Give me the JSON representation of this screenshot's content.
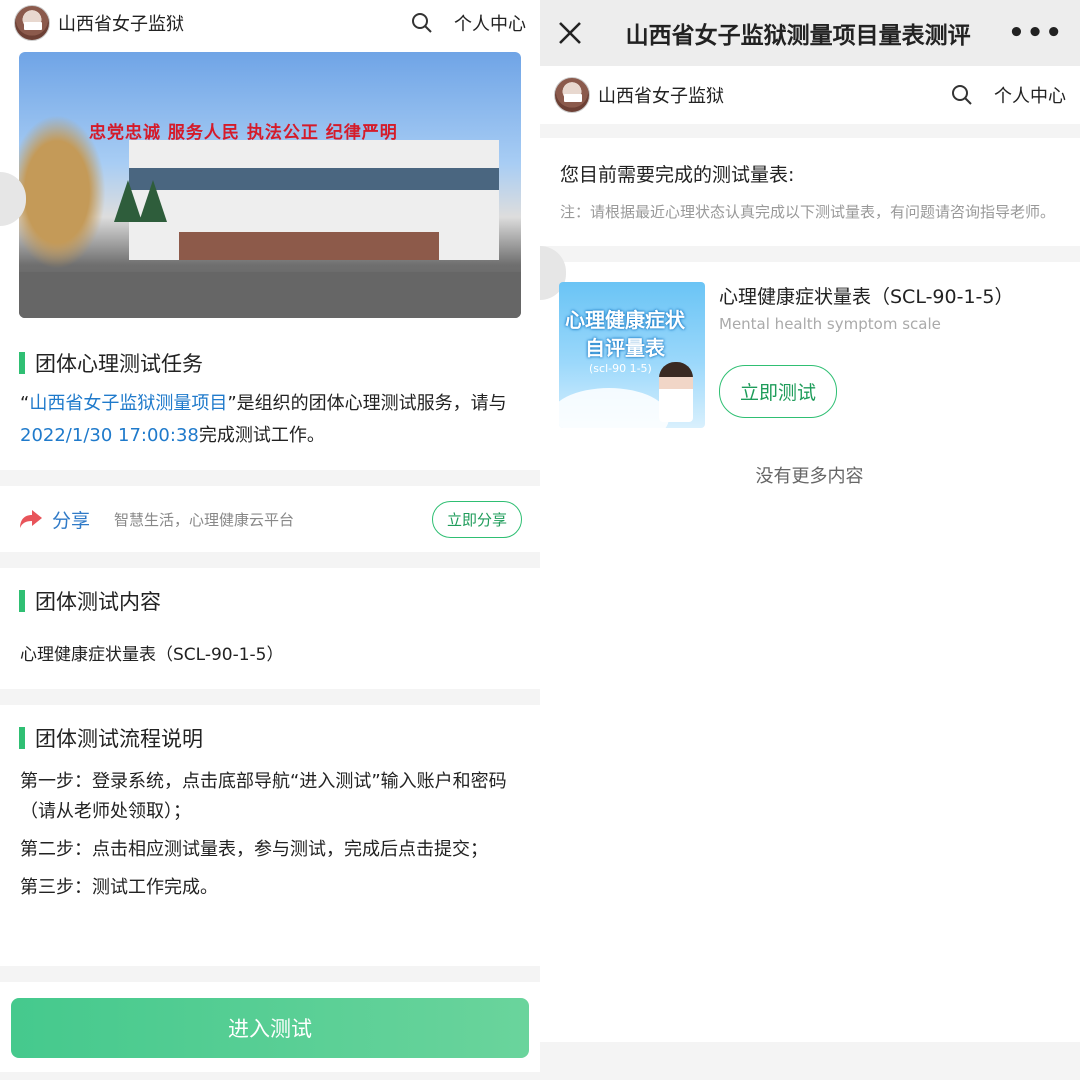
{
  "left": {
    "header": {
      "site_name": "山西省女子监狱",
      "user_center": "个人中心"
    },
    "hero": {
      "sign_text": "忠党忠诚 服务人民 执法公正 纪律严明"
    },
    "task": {
      "title": "团体心理测试任务",
      "desc_quote_open": "“",
      "project_name": "山西省女子监狱测量项目",
      "desc_mid": "”是组织的团体心理测试服务，请与",
      "deadline": "2022/1/30 17:00:38",
      "desc_end": "完成测试工作。"
    },
    "share": {
      "label": "分享",
      "slogan": "智慧生活，心理健康云平台",
      "button": "立即分享"
    },
    "content": {
      "title": "团体测试内容",
      "item": "心理健康症状量表（SCL-90-1-5）"
    },
    "process": {
      "title": "团体测试流程说明",
      "steps": [
        "第一步：登录系统，点击底部导航“进入测试”输入账户和密码（请从老师处领取）；",
        "第二步：点击相应测试量表，参与测试，完成后点击提交；",
        "第三步：测试工作完成。"
      ]
    },
    "enter_button": "进入测试"
  },
  "right": {
    "wx_title": "山西省女子监狱测量项目量表测评",
    "more": "•••",
    "header": {
      "site_name": "山西省女子监狱",
      "user_center": "个人中心"
    },
    "need_title": "您目前需要完成的测试量表:",
    "need_note": "注：请根据最近心理状态认真完成以下测试量表，有问题请咨询指导老师。",
    "scale": {
      "image_line1": "心理健康症状",
      "image_line2": "自评量表",
      "image_line3": "(scl-90 1-5)",
      "name": "心理健康症状量表（SCL-90-1-5）",
      "name_en": "Mental health symptom scale",
      "button": "立即测试"
    },
    "no_more": "没有更多内容"
  },
  "colors": {
    "accent_green": "#2fbf73",
    "link_blue": "#1f7acb",
    "share_red": "#e8545a"
  }
}
